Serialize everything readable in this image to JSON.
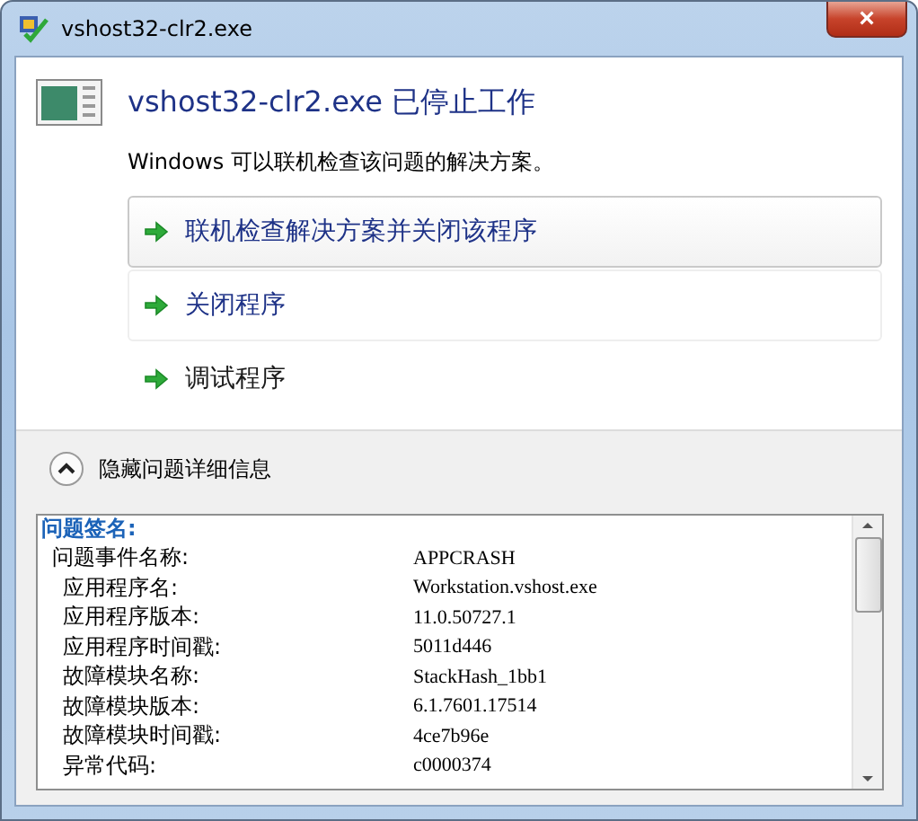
{
  "window": {
    "title": "vshost32-clr2.exe",
    "close": "×"
  },
  "heading": "vshost32-clr2.exe 已停止工作",
  "message": "Windows 可以联机检查该问题的解决方案。",
  "options": [
    {
      "label": "联机检查解决方案并关闭该程序",
      "kind": "boxed",
      "focused": true
    },
    {
      "label": "关闭程序",
      "kind": "boxed",
      "focused": false
    },
    {
      "label": "调试程序",
      "kind": "plain",
      "focused": false
    }
  ],
  "details_toggle": {
    "label": "隐藏问题详细信息",
    "expanded": true
  },
  "details": {
    "title": "问题签名:",
    "rows": [
      {
        "kind": "event",
        "label": "问题事件名称:",
        "value": "APPCRASH"
      },
      {
        "kind": "param",
        "label": "应用程序名:",
        "value": "Workstation.vshost.exe"
      },
      {
        "kind": "param",
        "label": "应用程序版本:",
        "value": "11.0.50727.1"
      },
      {
        "kind": "param",
        "label": "应用程序时间戳:",
        "value": "5011d446"
      },
      {
        "kind": "param",
        "label": "故障模块名称:",
        "value": "StackHash_1bb1"
      },
      {
        "kind": "param",
        "label": "故障模块版本:",
        "value": "6.1.7601.17514"
      },
      {
        "kind": "param",
        "label": "故障模块时间戳:",
        "value": "4ce7b96e"
      },
      {
        "kind": "param",
        "label": "异常代码:",
        "value": "c0000374"
      }
    ]
  }
}
